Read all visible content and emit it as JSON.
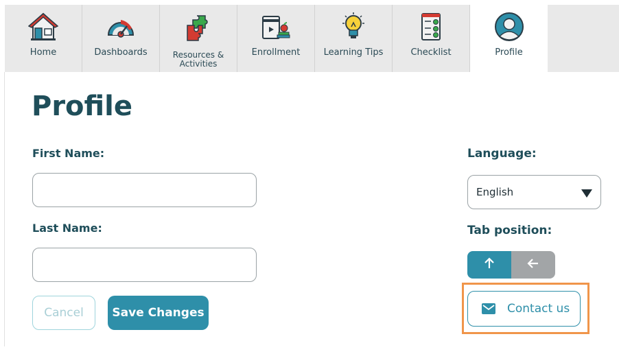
{
  "tabs": [
    {
      "label": "Home",
      "icon": "house-icon"
    },
    {
      "label": "Dashboards",
      "icon": "gauge-icon"
    },
    {
      "label": "Resources & Activities",
      "icon": "puzzle-icon"
    },
    {
      "label": "Enrollment",
      "icon": "tablet-books-icon"
    },
    {
      "label": "Learning Tips",
      "icon": "lightbulb-icon"
    },
    {
      "label": "Checklist",
      "icon": "checklist-icon"
    },
    {
      "label": "Profile",
      "icon": "user-avatar-icon",
      "active": true
    }
  ],
  "page": {
    "title": "Profile"
  },
  "form": {
    "first_name_label": "First Name:",
    "first_name_value": "",
    "last_name_label": "Last Name:",
    "last_name_value": "",
    "cancel_label": "Cancel",
    "save_label": "Save Changes"
  },
  "settings": {
    "language_label": "Language:",
    "language_value": "English",
    "tab_position_label": "Tab position:",
    "tab_position_options": [
      "up",
      "left"
    ],
    "tab_position_selected": "up"
  },
  "contact": {
    "label": "Contact us",
    "icon": "envelope-icon"
  },
  "colors": {
    "accent": "#2e8fa9",
    "heading": "#1f4e5a",
    "highlight": "#f0954a",
    "inactive": "#a2a5a7"
  }
}
